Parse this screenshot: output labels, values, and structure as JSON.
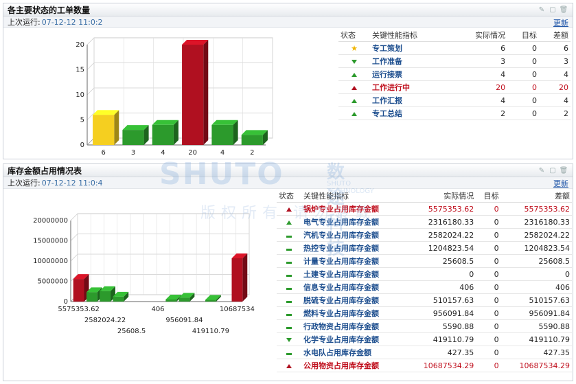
{
  "panel1": {
    "title": "各主要状态的工单数量",
    "run_label": "上次运行:",
    "run_value": "07-12-12 11:0:2",
    "update": "更新",
    "headers": [
      "状态",
      "关键性能指标",
      "实际情况",
      "目标",
      "差额"
    ],
    "rows": [
      {
        "status": "star",
        "name": "专工策划",
        "actual": "6",
        "target": "0",
        "diff": "6",
        "hi": false
      },
      {
        "status": "down-green",
        "name": "工作准备",
        "actual": "3",
        "target": "0",
        "diff": "3",
        "hi": false
      },
      {
        "status": "up-green",
        "name": "运行接票",
        "actual": "4",
        "target": "0",
        "diff": "4",
        "hi": false
      },
      {
        "status": "up-red",
        "name": "工作进行中",
        "actual": "20",
        "target": "0",
        "diff": "20",
        "hi": true
      },
      {
        "status": "up-green",
        "name": "工作汇报",
        "actual": "4",
        "target": "0",
        "diff": "4",
        "hi": false
      },
      {
        "status": "up-green",
        "name": "专工总结",
        "actual": "2",
        "target": "0",
        "diff": "2",
        "hi": false
      }
    ]
  },
  "panel2": {
    "title": "库存金额占用情况表",
    "run_label": "上次运行:",
    "run_value": "07-12-12 11:0:4",
    "update": "更新",
    "headers": [
      "状态",
      "关键性能指标",
      "实际情况",
      "目标",
      "差额"
    ],
    "rows": [
      {
        "status": "up-red",
        "name": "锅炉专业占用库存金额",
        "actual": "5575353.62",
        "target": "0",
        "diff": "5575353.62",
        "hi": true
      },
      {
        "status": "up-green",
        "name": "电气专业占用库存金额",
        "actual": "2316180.33",
        "target": "0",
        "diff": "2316180.33",
        "hi": false
      },
      {
        "status": "dash-green",
        "name": "汽机专业占用库存金额",
        "actual": "2582024.22",
        "target": "0",
        "diff": "2582024.22",
        "hi": false
      },
      {
        "status": "dash-green",
        "name": "热控专业占用库存金额",
        "actual": "1204823.54",
        "target": "0",
        "diff": "1204823.54",
        "hi": false
      },
      {
        "status": "dash-green",
        "name": "计量专业占用库存金额",
        "actual": "25608.5",
        "target": "0",
        "diff": "25608.5",
        "hi": false
      },
      {
        "status": "dash-green",
        "name": "土建专业占用库存金额",
        "actual": "0",
        "target": "0",
        "diff": "0",
        "hi": false
      },
      {
        "status": "dash-green",
        "name": "信息专业占用库存金额",
        "actual": "406",
        "target": "0",
        "diff": "406",
        "hi": false
      },
      {
        "status": "dash-green",
        "name": "脱硫专业占用库存金额",
        "actual": "510157.63",
        "target": "0",
        "diff": "510157.63",
        "hi": false
      },
      {
        "status": "dash-green",
        "name": "燃料专业占用库存金额",
        "actual": "956091.84",
        "target": "0",
        "diff": "956091.84",
        "hi": false
      },
      {
        "status": "dash-green",
        "name": "行政物资占用库存金额",
        "actual": "5590.88",
        "target": "0",
        "diff": "5590.88",
        "hi": false
      },
      {
        "status": "down-green",
        "name": "化学专业占用库存金额",
        "actual": "419110.79",
        "target": "0",
        "diff": "419110.79",
        "hi": false
      },
      {
        "status": "dash-green",
        "name": "水电队占用库存金额",
        "actual": "427.35",
        "target": "0",
        "diff": "427.35",
        "hi": false
      },
      {
        "status": "up-red",
        "name": "公用物资占用库存金额",
        "actual": "10687534.29",
        "target": "0",
        "diff": "10687534.29",
        "hi": true
      }
    ]
  },
  "watermark": {
    "brand": "SHUTO",
    "cn": "数途科技",
    "en": "SHUTO TECHNOLOGY",
    "sub": "版权所有 请勿转载"
  },
  "colors": {
    "green": "#2c9a2c",
    "red": "#b01020",
    "yellow": "#f5cf20",
    "link": "#1f55a8"
  },
  "chart_data": [
    {
      "type": "bar",
      "categories": [
        "6",
        "3",
        "4",
        "20",
        "4",
        "2"
      ],
      "values": [
        6,
        3,
        4,
        20,
        4,
        2
      ],
      "bar_colors": [
        "#f5cf20",
        "#2c9a2c",
        "#2c9a2c",
        "#b01020",
        "#2c9a2c",
        "#2c9a2c"
      ],
      "ylim": [
        0,
        20
      ],
      "yticks": [
        "0",
        "5",
        "10",
        "15",
        "20"
      ],
      "grid": true
    },
    {
      "type": "bar",
      "values": [
        5575353.62,
        2316180.33,
        2582024.22,
        1204823.54,
        25608.5,
        0,
        406,
        510157.63,
        956091.84,
        5590.88,
        419110.79,
        427.35,
        10687534.29
      ],
      "bar_colors": [
        "#b01020",
        "#2c9a2c",
        "#2c9a2c",
        "#2c9a2c",
        "#2c9a2c",
        "#2c9a2c",
        "#2c9a2c",
        "#2c9a2c",
        "#2c9a2c",
        "#2c9a2c",
        "#2c9a2c",
        "#2c9a2c",
        "#b01020"
      ],
      "ylim": [
        0,
        20000000
      ],
      "yticks": [
        "0",
        "5000000",
        "10000000",
        "15000000",
        "20000000"
      ],
      "xtick_labels": [
        "5575353.62",
        "2582024.22",
        "25608.5",
        "406",
        "956091.84",
        "419110.79",
        "10687534"
      ],
      "grid": true
    }
  ]
}
